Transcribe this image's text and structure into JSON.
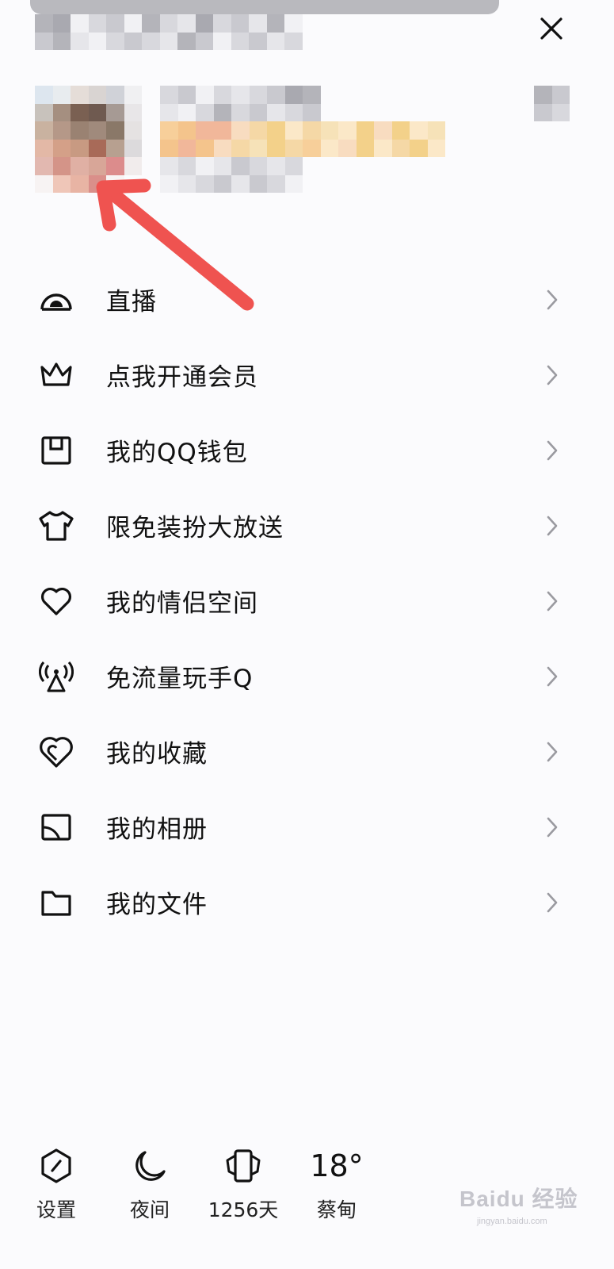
{
  "colors": {
    "background": "#fbfbfd",
    "text": "#111111",
    "chevron": "#9a9aa0",
    "annotation_arrow": "#ef5350"
  },
  "header": {
    "close_icon": "close-icon"
  },
  "menu": [
    {
      "icon": "live-icon",
      "label": "直播"
    },
    {
      "icon": "crown-icon",
      "label": "点我开通会员"
    },
    {
      "icon": "wallet-icon",
      "label": "我的QQ钱包"
    },
    {
      "icon": "tshirt-icon",
      "label": "限免装扮大放送"
    },
    {
      "icon": "heart-icon",
      "label": "我的情侣空间"
    },
    {
      "icon": "signal-tower-icon",
      "label": "免流量玩手Q"
    },
    {
      "icon": "favorite-icon",
      "label": "我的收藏"
    },
    {
      "icon": "album-icon",
      "label": "我的相册"
    },
    {
      "icon": "folder-icon",
      "label": "我的文件"
    }
  ],
  "footer": {
    "settings": {
      "icon": "settings-icon",
      "label": "设置"
    },
    "night": {
      "icon": "moon-icon",
      "label": "夜间"
    },
    "days": {
      "icon": "badge-icon",
      "label": "1256天"
    },
    "weather": {
      "temperature": "18°",
      "label": "蔡甸"
    }
  },
  "watermark": {
    "main": "Baidu 经验",
    "sub": "jingyan.baidu.com"
  }
}
